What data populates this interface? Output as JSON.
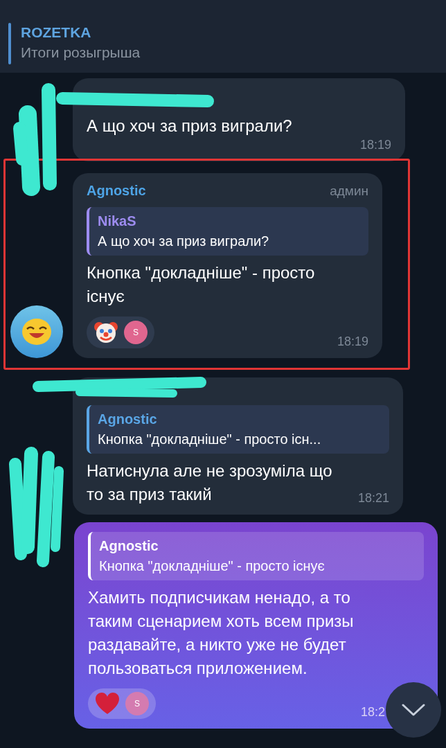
{
  "header": {
    "title": "ROZETKA",
    "subtitle": "Итоги розыгрыша"
  },
  "messages": [
    {
      "kind": "incoming",
      "highlighted": false,
      "text": "А що хоч за приз виграли?",
      "time": "18:19"
    },
    {
      "kind": "incoming",
      "highlighted": true,
      "sender": "Agnostic",
      "badge": "админ",
      "reply": {
        "name": "NikaS",
        "text": "А що хоч за приз виграли?",
        "color": "#9d8cf0"
      },
      "text": "Кнопка \"докладніше\" - просто існує",
      "reactions": [
        {
          "kind": "clown"
        },
        {
          "kind": "avatar",
          "initial": "S"
        }
      ],
      "time": "18:19",
      "avatar": true
    },
    {
      "kind": "incoming",
      "highlighted": false,
      "reply": {
        "name": "Agnostic",
        "text": "Кнопка \"докладніше\" - просто існ...",
        "color": "#5aa6e6"
      },
      "text": "Натиснула але не зрозуміла що то за приз такий",
      "time": "18:21"
    },
    {
      "kind": "outgoing",
      "highlighted": false,
      "reply": {
        "name": "Agnostic",
        "text": "Кнопка \"докладніше\" - просто існує",
        "color": "#ffffff"
      },
      "text": "Хамить подписчикам ненадо, а то таким сценарием хоть всем призы раздавайте, а никто уже не будет пользоваться приложением.",
      "reactions": [
        {
          "kind": "heart"
        },
        {
          "kind": "avatar",
          "initial": "S"
        }
      ],
      "time": "18:2"
    }
  ]
}
